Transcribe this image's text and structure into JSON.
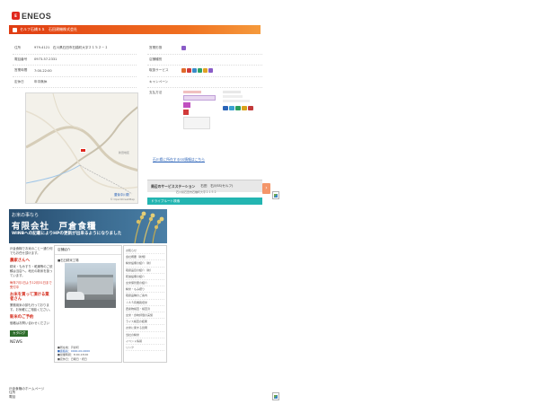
{
  "top": {
    "brand": "ENEOS",
    "station_title": "セルフ石橋ＳＳ　石田建機株式会社",
    "info_left": [
      {
        "label": "住所",
        "value": "979-4121　石川県石田市石橋町大字２１５２－１"
      },
      {
        "label": "電話番号",
        "value": "0973-57-2331"
      },
      {
        "label": "営業時間",
        "value": "7:00-22:00"
      },
      {
        "label": "定休日",
        "value": "年中無休"
      }
    ],
    "info_right": [
      {
        "label": "営業形態",
        "value": ""
      },
      {
        "label": "店舗種別",
        "value": ""
      },
      {
        "label": "取扱サービス",
        "value": ""
      },
      {
        "label": "キャンペーン",
        "value": ""
      }
    ],
    "pay_label": "支払方法",
    "more_link": "石川県に所在するSS情報はこちら",
    "nearby_title": "周辺のサービスステーション",
    "nearby_name": "石田　石川SS(セルフ)",
    "nearby_addr": "石川県石田市石橋町大字２１５２",
    "drive_label": "ドライブルート検索",
    "map_label": "豊後中川駅",
    "map_place": "新田地区",
    "map_credit": "© OpenStreetMap",
    "service_colors": [
      "#e06a2b",
      "#d13a3a",
      "#3a8cc8",
      "#2fa36b",
      "#e0a224",
      "#8a5cc7"
    ],
    "pay_colors": [
      "#2a64b8",
      "#3aa0d0",
      "#2b9f5c",
      "#d8a21a",
      "#c23a3a"
    ]
  },
  "bottom": {
    "banner_line1": "お米の事なら",
    "banner_line2": "有限会社　戸倉食糧",
    "banner_line3": "WINBへの記載によりHPの更新が出来るようになりました",
    "left_intro": "戸倉食糧でお米のこと一通り何でもお任せ頂けます。",
    "left_heading": "農家さんへ",
    "left_text": "精米・もみすり・乾燥等のご依頼は当店へ。地元の新米を扱っています。",
    "left_notice": "毎年7月1日より12月31日まで受付中",
    "left_heading2": "お米を買って頂ける業者さん",
    "left_text2": "業務用米の卸も行っております。お気軽にご相談ください。",
    "left_heading3": "新米のご予約",
    "left_text3": "価格はお問い合わせください",
    "badge": "カタログ",
    "news": "NEWS",
    "mid_header": "店舗紹介",
    "mid_caption": "■石臼精米工場",
    "mid_info": [
      "■所在地：戸倉町",
      "■連絡先：0000-00-0000",
      "■営業時間：8:00-18:00",
      "■定休日：日曜日・祝日"
    ],
    "right_items": [
      "お知らせ",
      "会社概要（新規）",
      "精米設備の紹介（新）",
      "取扱品目の紹介（新）",
      "乾燥設備の紹介",
      "玄米保管庫の紹介",
      "精米・もみ摺り",
      "取扱品種のご案内",
      "ＪＡＳ有機栽培米",
      "農産物検査・検査済",
      "玄米・食味評価の実施",
      "ライス検査の結果",
      "お米に関する質問",
      "当社の精米",
      "イベント情報",
      "リンク"
    ],
    "footer_lines": [
      "戸倉食糧のホームページ",
      "住所",
      "電話"
    ]
  }
}
